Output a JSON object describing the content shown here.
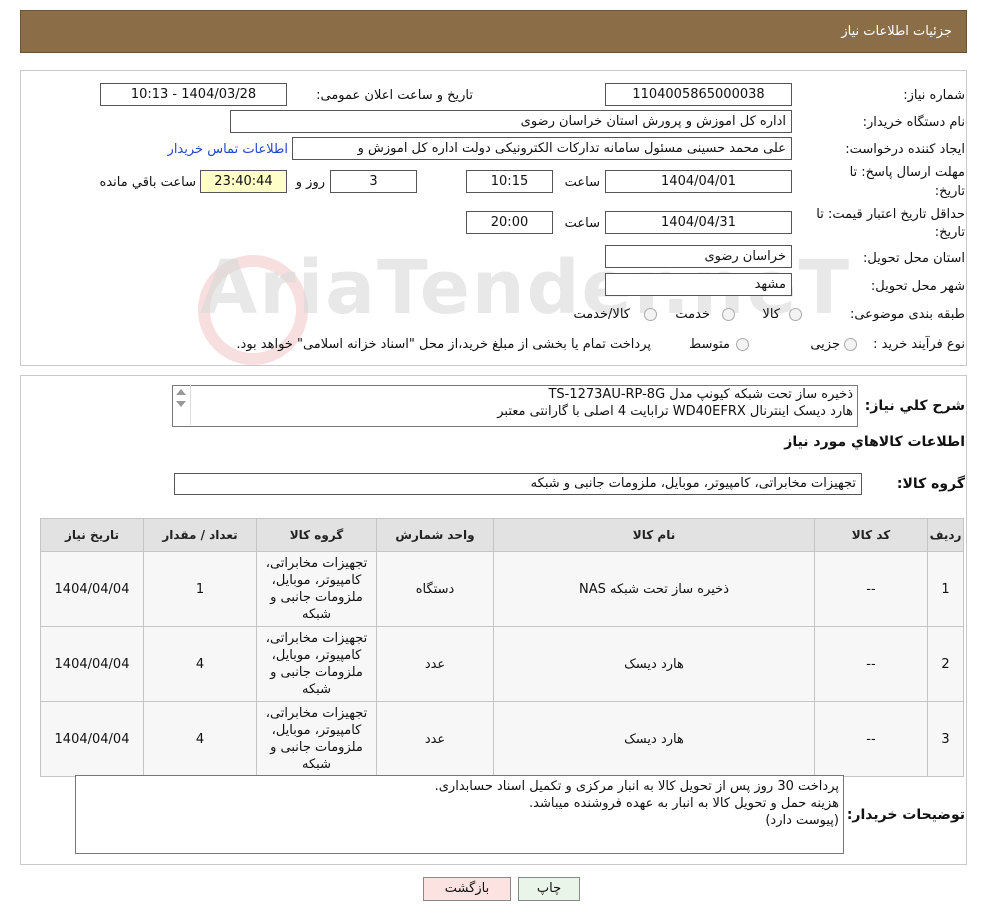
{
  "header": {
    "title": "جزئیات اطلاعات نیاز"
  },
  "form": {
    "need_number_label": "شماره نیاز:",
    "need_number": "1104005865000038",
    "announce_label": "تاریخ و ساعت اعلان عمومی:",
    "announce_value": "1404/03/28 - 10:13",
    "buyer_org_label": "نام دستگاه خریدار:",
    "buyer_org": "اداره کل اموزش و پرورش استان خراسان رضوی",
    "creator_label": "ایجاد کننده درخواست:",
    "creator": "علی محمد حسینی مسئول سامانه تدارکات الکترونیکی دولت اداره کل اموزش و",
    "contact_link": "اطلاعات تماس خریدار",
    "deadline_label_1": "مهلت ارسال پاسخ: تا",
    "deadline_label_2": "تاریخ:",
    "deadline_date": "1404/04/01",
    "time_label": "ساعت",
    "deadline_time": "10:15",
    "days": "3",
    "days_label": "روز و",
    "remaining": "23:40:44",
    "remaining_label": "ساعت باقي مانده",
    "validity_label_1": "حداقل تاریخ اعتبار قیمت: تا",
    "validity_label_2": "تاریخ:",
    "validity_date": "1404/04/31",
    "validity_time": "20:00",
    "province_label": "استان محل تحویل:",
    "province": "خراسان رضوی",
    "city_label": "شهر محل تحویل:",
    "city": "مشهد",
    "category_label": "طبقه بندی موضوعی:",
    "cat_goods": "کالا",
    "cat_service": "خدمت",
    "cat_both": "کالا/خدمت",
    "process_label": "نوع فرآیند خرید :",
    "proc_partial": "جزیی",
    "proc_medium": "متوسط",
    "proc_note": "پرداخت تمام یا بخشی از مبلغ خرید،از محل \"اسناد خزانه اسلامی\" خواهد بود."
  },
  "summary": {
    "label": "شرح کلي نياز:",
    "line1": "ذخیره ساز تحت شبکه کیونپ مدل TS-1273AU-RP-8G",
    "line2": "هارد دیسک اینترنال WD40EFRX ترابایت 4 اصلی با گارانتی معتبر"
  },
  "goods_info_title": "اطلاعات کالاهاي مورد نياز",
  "goods_group": {
    "label": "گروه کالا:",
    "value": "تجهیزات مخابراتی، کامپیوتر، موبایل، ملزومات جانبی و شبکه"
  },
  "table": {
    "headers": [
      "رديف",
      "کد کالا",
      "نام کالا",
      "واحد شمارش",
      "گروه کالا",
      "تعداد / مقدار",
      "تاریخ نیاز"
    ],
    "rows": [
      {
        "idx": "1",
        "code": "--",
        "name": "ذخیره ساز تحت شبکه NAS",
        "unit": "دستگاه",
        "group": "تجهیزات مخابراتی، کامپیوتر، موبایل، ملزومات جانبی و شبکه",
        "qty": "1",
        "date": "1404/04/04"
      },
      {
        "idx": "2",
        "code": "--",
        "name": "هارد دیسک",
        "unit": "عدد",
        "group": "تجهیزات مخابراتی، کامپیوتر، موبایل، ملزومات جانبی و شبکه",
        "qty": "4",
        "date": "1404/04/04"
      },
      {
        "idx": "3",
        "code": "--",
        "name": "هارد دیسک",
        "unit": "عدد",
        "group": "تجهیزات مخابراتی، کامپیوتر، موبایل، ملزومات جانبی و شبکه",
        "qty": "4",
        "date": "1404/04/04"
      }
    ]
  },
  "buyer_notes": {
    "label": "توضیحات خریدار:",
    "line1": "پرداخت 30 روز پس از تحویل کالا به انبار مرکزی و تکمیل اسناد حسابداری.",
    "line2": "هزینه حمل و تحویل کالا به انبار به عهده فروشنده میباشد.",
    "line3": "(پیوست دارد)"
  },
  "buttons": {
    "print": "چاپ",
    "back": "بازگشت"
  },
  "watermark": "AriaTender.neT"
}
